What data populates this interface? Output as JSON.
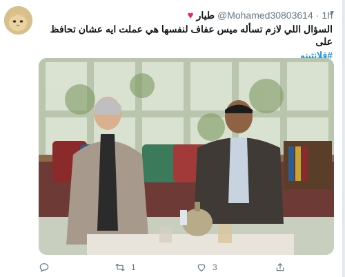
{
  "tweet": {
    "display_name": "طيار",
    "handle": "@Mohamed30803614",
    "separator": "·",
    "time": "1h",
    "text": "السؤال اللي لازم تسأله ميس عفاف لنفسها هي عملت ايه عشان تحافظ على",
    "hashtag": "#فلانتينو",
    "replies": "",
    "retweets": "1",
    "likes": "3"
  },
  "icons": {
    "heart_emoji": "heart-emoji",
    "reply": "reply-icon",
    "retweet": "retweet-icon",
    "like": "like-icon",
    "share": "share-icon",
    "caret": "chevron-down-icon"
  },
  "colors": {
    "link": "#1b95e0",
    "muted": "#657786",
    "heart": "#e0245e"
  }
}
